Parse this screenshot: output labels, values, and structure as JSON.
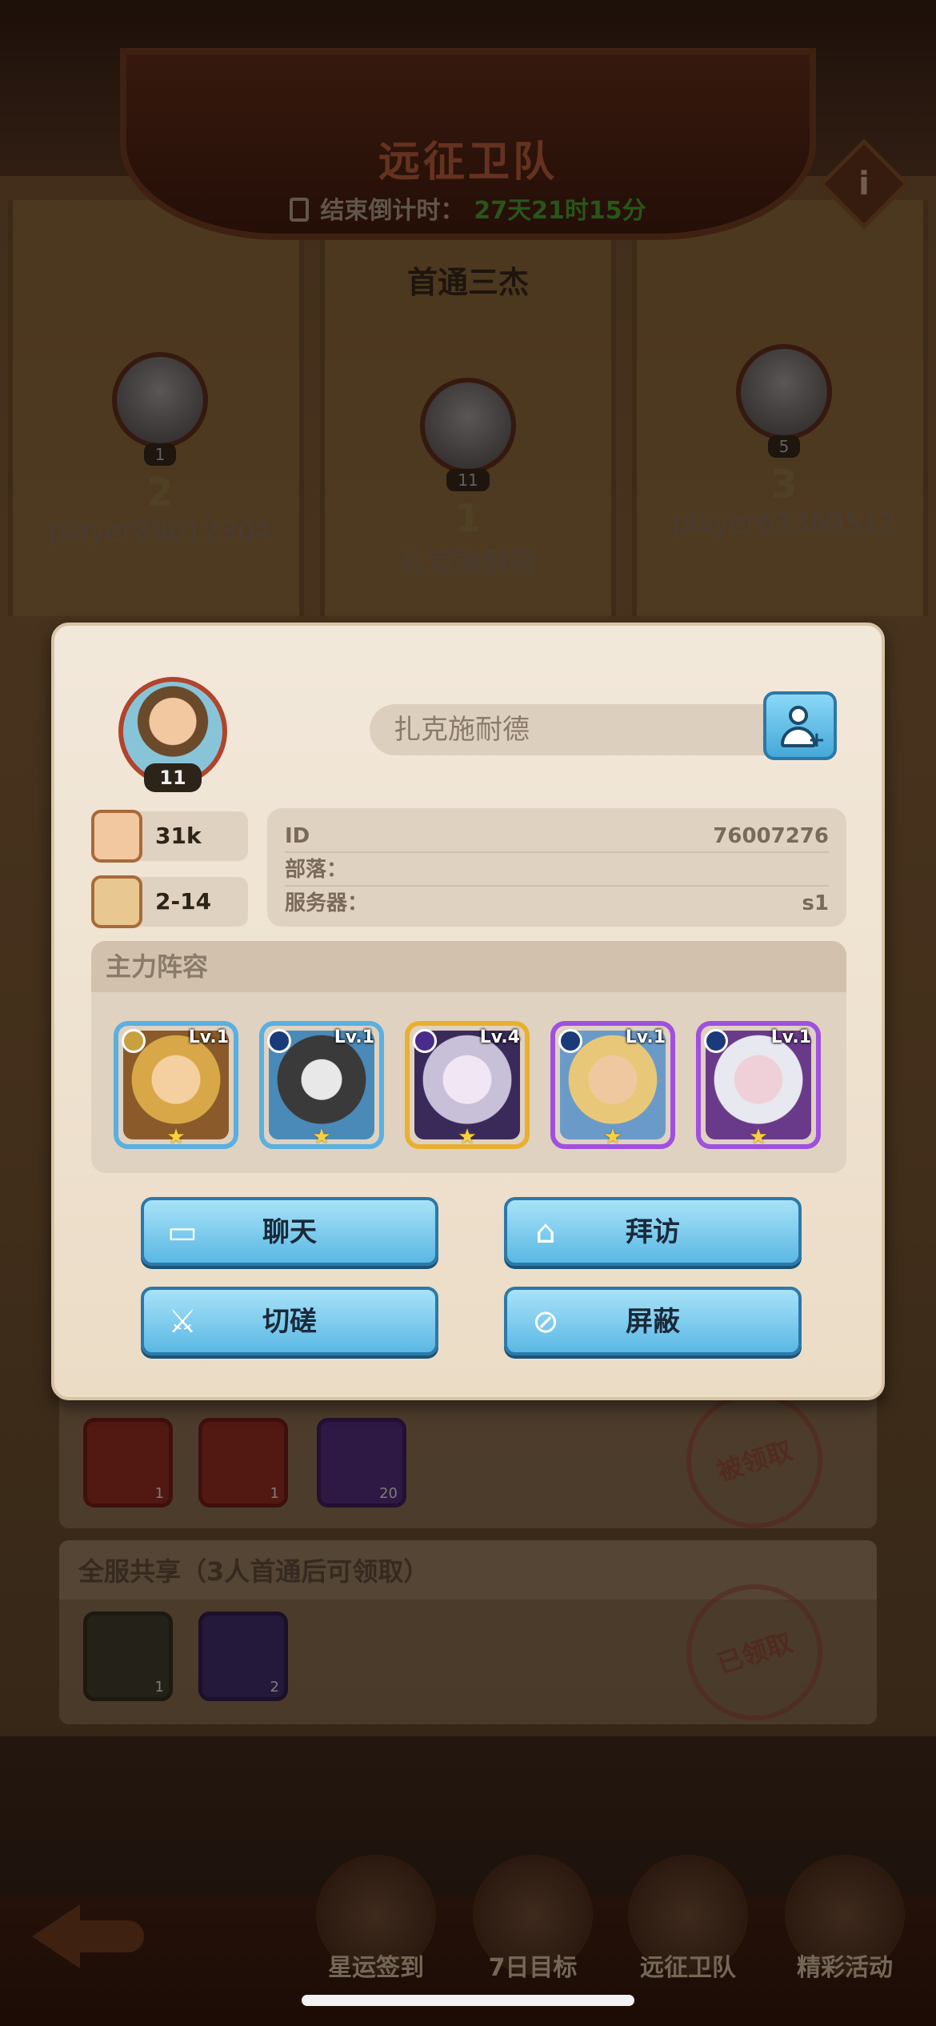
{
  "header": {
    "title": "远征卫队",
    "countdown_label": "结束倒计时：",
    "countdown_value": "27天21时15分",
    "info_glyph": "i"
  },
  "section_title": "首通三杰",
  "top3": [
    {
      "rank": "2",
      "level": "1",
      "name": "player89012304"
    },
    {
      "rank": "1",
      "level": "11",
      "name": "扎克施耐德"
    },
    {
      "rank": "3",
      "level": "5",
      "name": "player63369512"
    }
  ],
  "modal": {
    "avatar_level": "11",
    "player_name": "扎克施耐德",
    "power": "31k",
    "stage": "2-14",
    "info": {
      "id_label": "ID",
      "id_value": "76007276",
      "tribe_label": "部落：",
      "tribe_value": "",
      "server_label": "服务器：",
      "server_value": "s1"
    },
    "lineup_title": "主力阵容",
    "heroes": [
      {
        "level": "Lv.1",
        "element": "light",
        "frame": "blue"
      },
      {
        "level": "Lv.1",
        "element": "water",
        "frame": "blue"
      },
      {
        "level": "Lv.4",
        "element": "dark",
        "frame": "gold"
      },
      {
        "level": "Lv.1",
        "element": "water",
        "frame": "purple"
      },
      {
        "level": "Lv.1",
        "element": "water",
        "frame": "purple"
      }
    ],
    "buttons": {
      "chat": "聊天",
      "visit": "拜访",
      "spar": "切磋",
      "block": "屏蔽"
    }
  },
  "rewards": {
    "row1_counts": [
      "1",
      "1",
      "20"
    ],
    "row1_stamp": "被领取",
    "shared_title": "全服共享（3人首通后可领取）",
    "row2_counts": [
      "1",
      "2"
    ],
    "row2_stamp": "已领取"
  },
  "bottom_nav": {
    "checkin": "星运签到",
    "seven_day": "7日目标",
    "expedition": "远征卫队",
    "events": "精彩活动"
  },
  "colors": {
    "button_blue": "#5ab8e4",
    "countdown_green": "#3f9a2c",
    "title_red": "#b0583a"
  }
}
